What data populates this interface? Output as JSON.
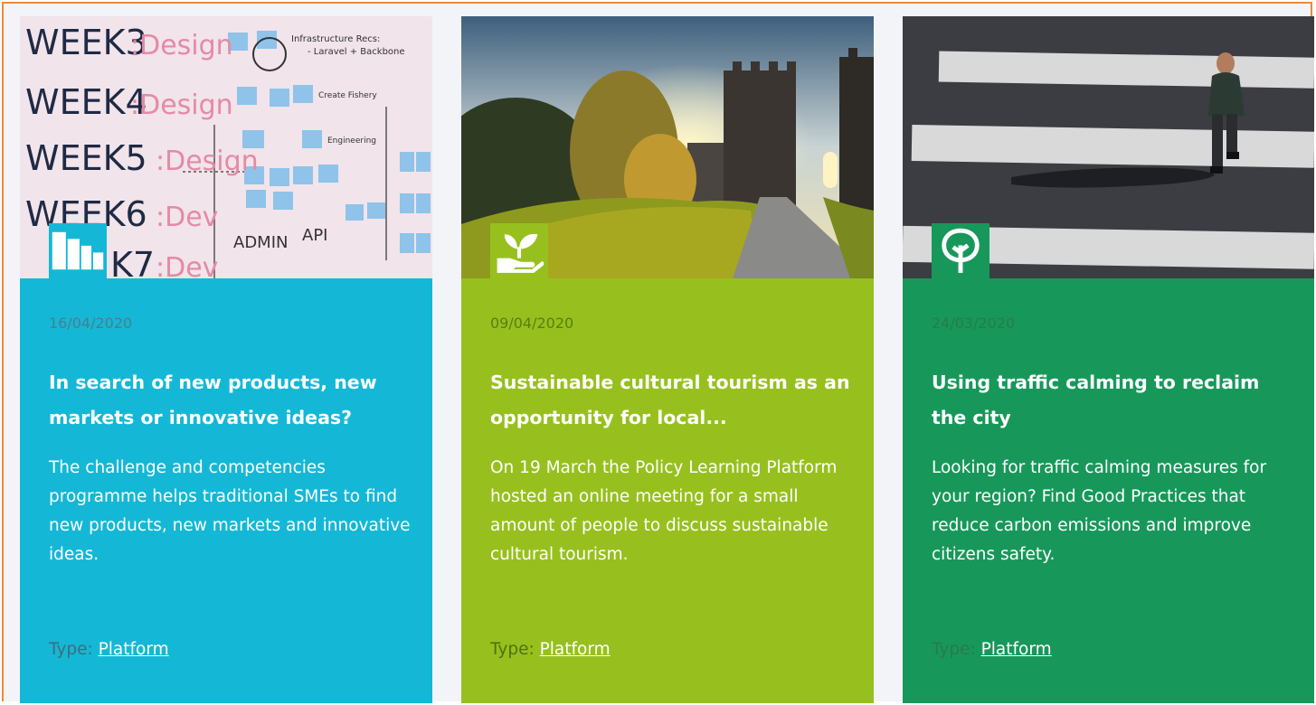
{
  "cards": [
    {
      "image_description_icon": "whiteboard-image",
      "category_icon": "buildings-icon",
      "date": "16/04/2020",
      "title": "In search of new products, new markets or innovative ideas?",
      "description": "The challenge and competencies programme helps traditional SMEs to find new products, new markets and innovative ideas.",
      "type_label": "Type:",
      "type_value": "Platform",
      "color": "#14b8d6",
      "whiteboard_text": [
        "WEEK3:Design",
        "WEEK4:Design",
        "WEEK5:Design",
        "WEEK6:Dev",
        "K7:Dev",
        "ADMIN API",
        "Infrastructure Recs: - Laravel + Backbone",
        "Create Fishery",
        "Engineering"
      ]
    },
    {
      "image_description_icon": "castle-path-image",
      "category_icon": "hand-plant-icon",
      "date": "09/04/2020",
      "title": "Sustainable cultural tourism as an opportunity for local...",
      "description": "On 19 March the Policy Learning Platform hosted an online meeting for a small amount of people to discuss sustainable cultural tourism.",
      "type_label": "Type:",
      "type_value": "Platform",
      "color": "#97c01e"
    },
    {
      "image_description_icon": "crosswalk-image",
      "category_icon": "tree-icon",
      "date": "24/03/2020",
      "title": "Using traffic calming to reclaim the city",
      "description": "Looking for traffic calming measures for your region? Find Good Practices that reduce carbon emissions and improve citizens safety.",
      "type_label": "Type:",
      "type_value": "Platform",
      "color": "#17985a"
    }
  ]
}
